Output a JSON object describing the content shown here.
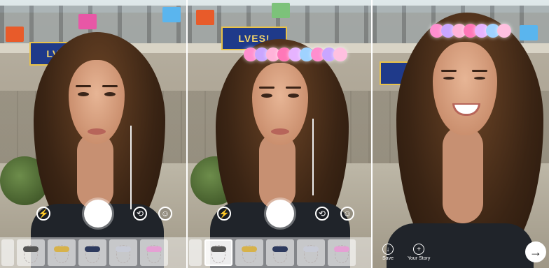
{
  "banner": {
    "text": "LVES!"
  },
  "colors": {
    "banner_bg": "#1f3a8a",
    "banner_fg": "#f3d46a",
    "flower_colors": [
      "#ff8fcf",
      "#c9a6ff",
      "#ffb3d9",
      "#9fd2ff",
      "#ff77b8",
      "#e6b3ff",
      "#ffc0e0"
    ]
  },
  "panels": [
    {
      "id": "camera-no-filter",
      "controls": [
        "flash-icon",
        "capture-button",
        "switch-camera-icon",
        "face-filter-icon"
      ]
    },
    {
      "id": "camera-flower-crown",
      "controls": [
        "flash-icon",
        "capture-button",
        "switch-camera-icon",
        "face-filter-icon"
      ]
    },
    {
      "id": "preview-flower-crown",
      "controls": [
        "download-icon",
        "story-add-icon",
        "send-arrow-icon"
      ]
    }
  ],
  "filters": [
    {
      "name": "flower-crown-filter",
      "deco_color": "#ff9ccf"
    },
    {
      "name": "glasses-filter",
      "deco_color": "#555555"
    },
    {
      "name": "gold-crown-filter",
      "deco_color": "#d7b24a"
    },
    {
      "name": "dark-crown-filter",
      "deco_color": "#2d3a5e"
    },
    {
      "name": "silver-tiara-filter",
      "deco_color": "#c8cbd6"
    },
    {
      "name": "pink-tiara-filter",
      "deco_color": "#e5a0d4"
    }
  ],
  "preview": {
    "save_label": "Save",
    "story_label": "Your Story"
  }
}
